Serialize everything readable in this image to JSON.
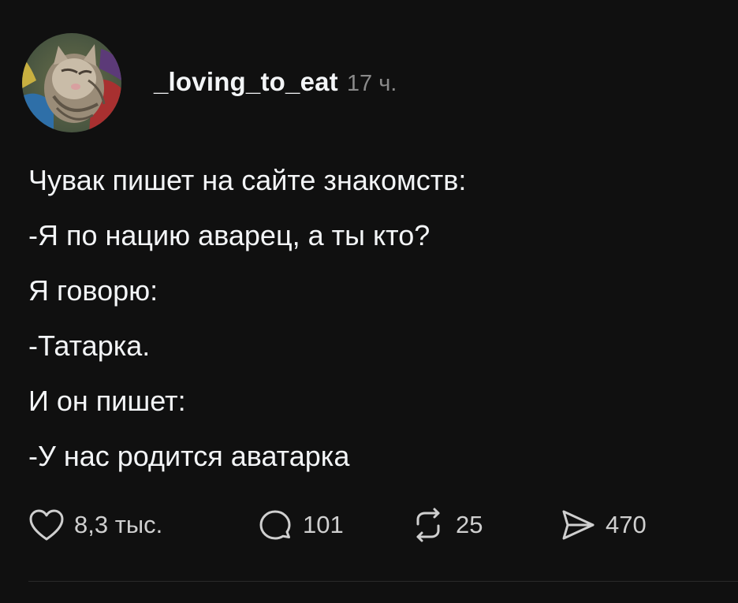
{
  "post": {
    "username": "_loving_to_eat",
    "time_ago": "17 ч.",
    "avatar_icon": "cat-photo-avatar",
    "text_lines": [
      "Чувак пишет на сайте знакомств:",
      "-Я по нацию аварец, а ты кто?",
      "Я говорю:",
      "-Татарка.",
      "И он пишет:",
      "-У нас родится аватарка"
    ]
  },
  "actions": {
    "likes": {
      "icon": "heart-icon",
      "count": "8,3 тыс."
    },
    "comments": {
      "icon": "comment-icon",
      "count": "101"
    },
    "reposts": {
      "icon": "repost-icon",
      "count": "25"
    },
    "shares": {
      "icon": "send-icon",
      "count": "470"
    }
  },
  "colors": {
    "background": "#101010",
    "text": "#f3f5f7",
    "secondary_text": "#8a8a8a",
    "icon": "#cfcfcf"
  }
}
